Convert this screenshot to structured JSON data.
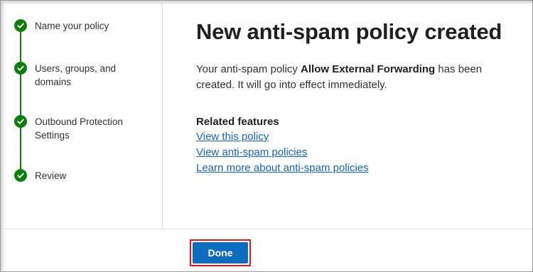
{
  "steps": [
    {
      "label": "Name your policy",
      "status": "complete"
    },
    {
      "label": "Users, groups, and domains",
      "status": "complete"
    },
    {
      "label": "Outbound Protection Settings",
      "status": "complete"
    },
    {
      "label": "Review",
      "status": "complete"
    }
  ],
  "colors": {
    "step_complete": "#107c10",
    "link": "#1766b5",
    "primary_button": "#0f6cbd",
    "highlight": "#e0141e"
  },
  "main": {
    "title": "New anti-spam policy created",
    "desc_prefix": "Your anti-spam policy ",
    "policy_name": "Allow External Forwarding",
    "desc_suffix": " has been created. It will go into effect immediately.",
    "related_title": "Related features",
    "links": [
      "View this policy",
      "View anti-spam policies",
      "Learn more about anti-spam policies"
    ]
  },
  "footer": {
    "done_label": "Done"
  }
}
